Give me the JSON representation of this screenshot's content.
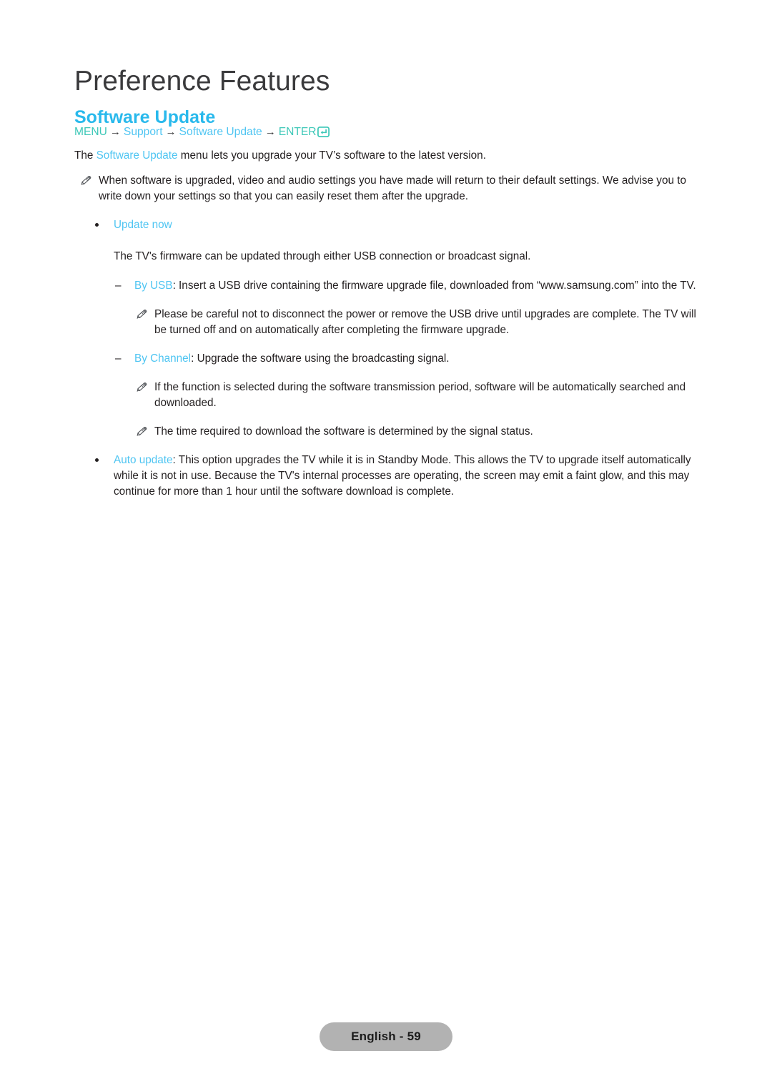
{
  "header": {
    "chapter_title": "Preference Features",
    "section_title": "Software Update"
  },
  "colors": {
    "section_heading": "#29b9ec",
    "keyword_blue": "#4fc5f2",
    "keyword_teal": "#3ec8b8",
    "body_text": "#231f20",
    "chapter_title": "#3a3a3c",
    "page_badge_bg": "#b2b2b2"
  },
  "breadcrumb": {
    "menu": "MENU",
    "arrow": "→",
    "support": "Support",
    "software_update": "Software Update",
    "enter": "ENTER",
    "enter_icon": "enter-key-icon"
  },
  "intro": {
    "before": "The ",
    "keyword": "Software Update",
    "after": " menu lets you upgrade your TV’s software to the latest version."
  },
  "notes": {
    "upgrade_defaults": "When software is upgraded, video and audio settings you have made will return to their default settings. We advise you to write down your settings so that you can easily reset them after the upgrade.",
    "usb_careful": "Please be careful not to disconnect the power or remove the USB drive until upgrades are complete. The TV will be turned off and on automatically after completing the firmware upgrade.",
    "transmission_period": "If the function is selected during the software transmission period, software will be automatically searched and downloaded.",
    "time_required": "The time required to download the software is determined by the signal status."
  },
  "update_now": {
    "label": "Update now",
    "description": "The TV's firmware can be updated through either USB connection or broadcast signal.",
    "by_usb": {
      "keyword": "By USB",
      "text": ": Insert a USB drive containing the firmware upgrade file, downloaded from “www.samsung.com” into the TV."
    },
    "by_channel": {
      "keyword": "By Channel",
      "text": ": Upgrade the software using the broadcasting signal."
    }
  },
  "auto_update": {
    "keyword": "Auto update",
    "text": ": This option upgrades the TV while it is in Standby Mode. This allows the TV to upgrade itself automatically while it is not in use. Because the TV's internal processes are operating, the screen may emit a faint glow, and this may continue for more than 1 hour until the software download is complete."
  },
  "footer": {
    "page_label": "English - 59"
  }
}
